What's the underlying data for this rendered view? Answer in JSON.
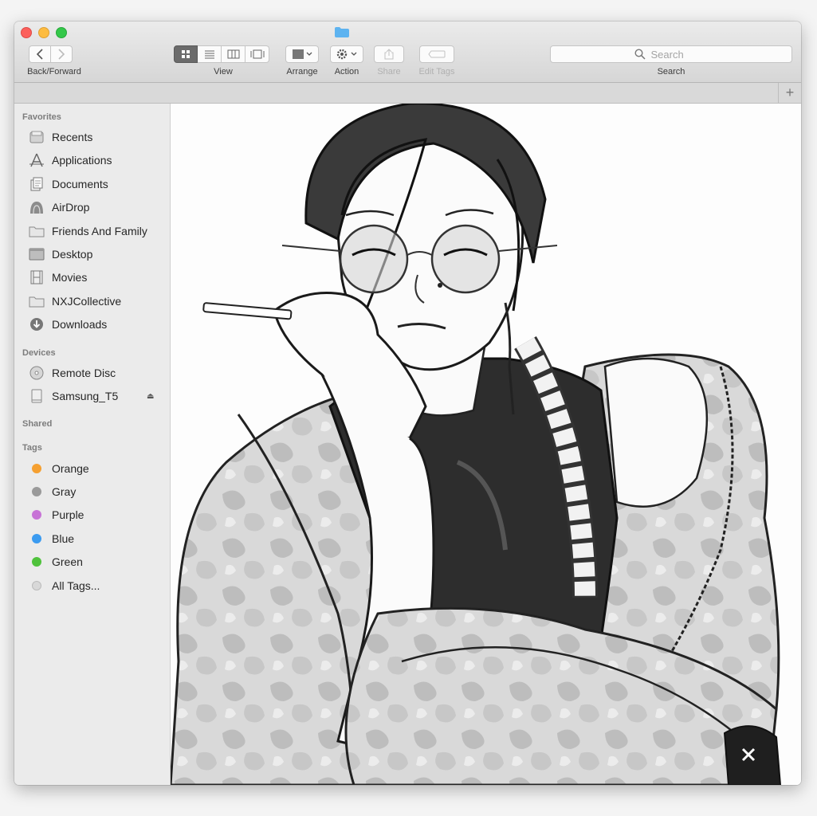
{
  "toolbar": {
    "back_forward_label": "Back/Forward",
    "view_label": "View",
    "arrange_label": "Arrange",
    "action_label": "Action",
    "share_label": "Share",
    "edit_tags_label": "Edit Tags",
    "search_label": "Search",
    "search_placeholder": "Search"
  },
  "sidebar": {
    "favorites_header": "Favorites",
    "favorites": [
      {
        "label": "Recents",
        "icon": "recents-icon"
      },
      {
        "label": "Applications",
        "icon": "applications-icon"
      },
      {
        "label": "Documents",
        "icon": "documents-icon"
      },
      {
        "label": "AirDrop",
        "icon": "airdrop-icon"
      },
      {
        "label": "Friends And Family",
        "icon": "folder-icon"
      },
      {
        "label": "Desktop",
        "icon": "desktop-icon"
      },
      {
        "label": "Movies",
        "icon": "movies-icon"
      },
      {
        "label": "NXJCollective",
        "icon": "folder-icon"
      },
      {
        "label": "Downloads",
        "icon": "downloads-icon"
      }
    ],
    "devices_header": "Devices",
    "devices": [
      {
        "label": "Remote Disc",
        "icon": "disc-icon"
      },
      {
        "label": "Samsung_T5",
        "icon": "drive-icon"
      }
    ],
    "shared_header": "Shared",
    "tags_header": "Tags",
    "tags": [
      {
        "label": "Orange",
        "color": "#f5a031"
      },
      {
        "label": "Gray",
        "color": "#9a9a9a"
      },
      {
        "label": "Purple",
        "color": "#c773d6"
      },
      {
        "label": "Blue",
        "color": "#3b9bf0"
      },
      {
        "label": "Green",
        "color": "#4fc23c"
      },
      {
        "label": "All Tags...",
        "color": "#d8d8d8"
      }
    ]
  }
}
